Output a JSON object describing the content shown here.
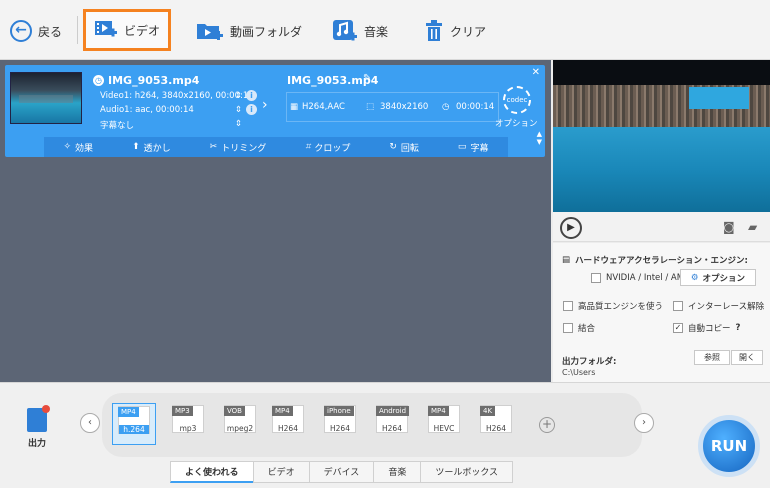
{
  "toolbar": {
    "back_label": "戻る",
    "video_label": "ビデオ",
    "folder_label": "動画フォルダ",
    "music_label": "音楽",
    "clear_label": "クリア"
  },
  "file": {
    "name": "IMG_9053.mp4",
    "video_info": "Video1: h264, 3840x2160, 00:00:14",
    "audio_info": "Audio1: aac, 00:00:14",
    "subtitle": "字幕なし",
    "output_name": "IMG_9053.mp4",
    "output_codec": "H264,AAC",
    "output_resolution": "3840x2160",
    "output_duration": "00:00:14",
    "codec_label": "codec",
    "option_label": "オプション"
  },
  "edit_bar": {
    "effect": "効果",
    "watermark": "透かし",
    "trim": "トリミング",
    "crop": "クロップ",
    "rotate": "回転",
    "subtitle": "字幕"
  },
  "settings": {
    "hw_title": "ハードウェアアクセラレーション・エンジン:",
    "gpu_label": "NVIDIA / Intel / AMD",
    "option_btn": "オプション",
    "hq_engine": "高品質エンジンを使う",
    "deinterlace": "インターレース解除",
    "merge": "結合",
    "auto_copy": "自動コピー",
    "auto_copy_help": "?",
    "output_folder_label": "出力フォルダ:",
    "browse_btn": "参照",
    "open_btn": "開く",
    "output_path": "C:\\Users"
  },
  "output": {
    "label": "出力"
  },
  "formats": [
    {
      "tag": "MP4",
      "sub": "h.264",
      "selected": true
    },
    {
      "tag": "MP3",
      "sub": "mp3",
      "selected": false
    },
    {
      "tag": "VOB",
      "sub": "mpeg2",
      "selected": false
    },
    {
      "tag": "MP4",
      "sub": "H264",
      "selected": false
    },
    {
      "tag": "iPhone",
      "sub": "H264",
      "selected": false
    },
    {
      "tag": "Android",
      "sub": "H264",
      "selected": false
    },
    {
      "tag": "MP4",
      "sub": "HEVC",
      "selected": false
    },
    {
      "tag": "4K",
      "sub": "H264",
      "selected": false
    }
  ],
  "tabs": [
    "よく使われる",
    "ビデオ",
    "デバイス",
    "音楽",
    "ツールボックス"
  ],
  "run_label": "RUN"
}
